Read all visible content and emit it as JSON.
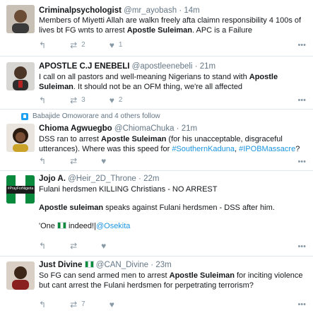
{
  "tweets": [
    {
      "name": "Criminalpsychologist",
      "handle": "@mr_ayobash",
      "time": "14m",
      "text": "Members of Miyetti Allah are walkn freely afta claimn responsibility 4 100s of lives bt FG wnts to arrest Apostle Suleiman. APC is a Failure",
      "retweets": "2",
      "likes": "1"
    },
    {
      "name": "APOSTLE C.J ENEBELI",
      "handle": "@apostleenebeli",
      "time": "21m",
      "text": "I call on all pastors  and well-meaning Nigerians to stand with Apostle Suleiman. It should not be an OFM thing, we're all affected",
      "retweets": "3",
      "likes": "2"
    },
    {
      "social": "Babajide Omoworare and 4 others follow",
      "name": "Chioma Agwuegbo",
      "handle": "@ChiomaChuka",
      "time": "21m",
      "text_pre": "DSS ran to arrest ",
      "text_bold": "Apostle Suleiman",
      "text_mid": " (for his unacceptable, disgraceful utterances). Where was this speed for ",
      "tag1": "#SouthernKaduna",
      "sep": ", ",
      "tag2": "#IPOBMassacre",
      "end": "?",
      "retweets": "",
      "likes": ""
    },
    {
      "name": "Jojo A.",
      "handle": "@Heir_2D_Throne",
      "time": "22m",
      "avatar_text": "#PrayForNigeria",
      "line1": "Fulani herdsmen KILLING Christians - NO ARREST",
      "line2_bold": "Apostle suleiman",
      "line2": " speaks against Fulani herdsmen - DSS after him.",
      "line3_a": "'One ",
      "line3_b": " indeed!|",
      "line3_link": "@Osekita",
      "retweets": "",
      "likes": ""
    },
    {
      "name": "Just Divine",
      "handle": "@CAN_Divine",
      "time": "23m",
      "text_pre": "So FG can send armed men to arrest ",
      "text_bold": "Apostle Suleiman",
      "text_post": " for inciting violence but cant arrest the Fulani herdsmen for perpetrating terrorism?",
      "retweets": "7",
      "likes": ""
    }
  ],
  "icons": {
    "reply": "reply-icon",
    "retweet": "retweet-icon",
    "like": "heart-icon",
    "more": "more-icon",
    "follow": "person-follow-icon"
  },
  "colors": {
    "link": "#1b95e0",
    "muted": "#657786",
    "icon": "#8899a6",
    "flag_green": "#0a8a3c"
  }
}
